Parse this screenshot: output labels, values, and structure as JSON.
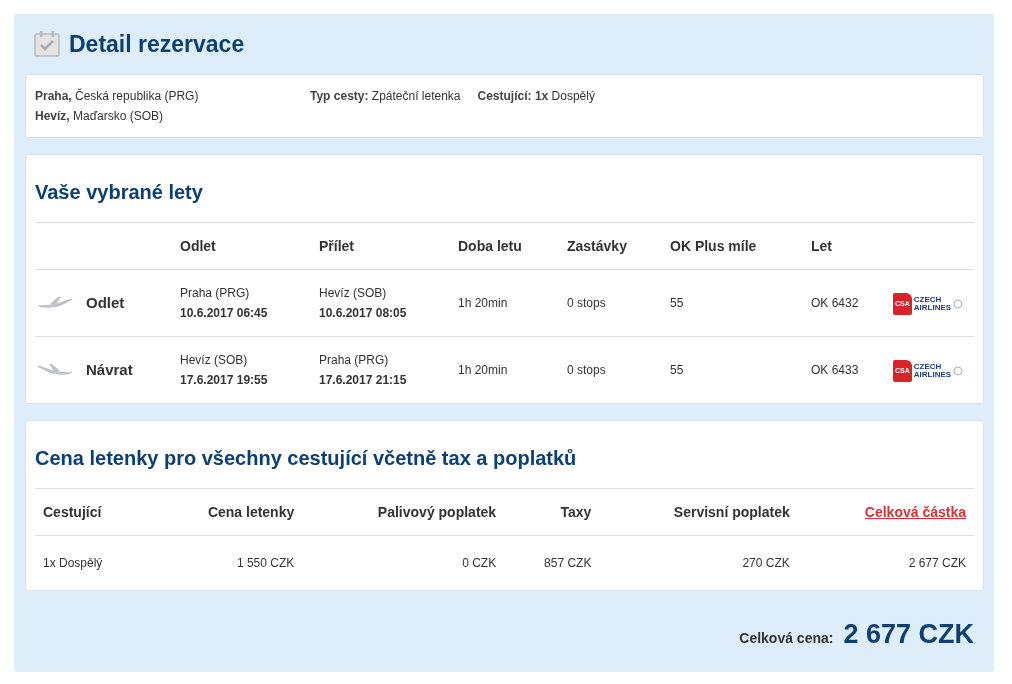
{
  "title": "Detail rezervace",
  "summary": {
    "routes": [
      "**Praha,** Česká republika (PRG)",
      "**Hevíz,** Maďarsko (SOB)"
    ],
    "trip_type": "**Typ cesty:** Zpáteční letenka",
    "passengers": "**Cestující:** **1x** Dospělý"
  },
  "flights": {
    "title": "Vaše vybrané lety",
    "columns": [
      "Odlet",
      "Přílet",
      "Doba letu",
      "Zastávky",
      "OK Plus míle",
      "Let"
    ],
    "rows": [
      {
        "kind": "outbound",
        "label": "Odlet",
        "from": "Praha (PRG)",
        "from_time": "10.6.2017 06:45",
        "to": "Hevíz (SOB)",
        "to_time": "10.6.2017 08:05",
        "duration": "1h 20min",
        "stops": "0 stops",
        "miles": "55",
        "flight": "OK 6432",
        "logo": [
          "CSA",
          "CZECH",
          "AIRLINES"
        ]
      },
      {
        "kind": "return",
        "label": "Návrat",
        "from": "Hevíz (SOB)",
        "from_time": "17.6.2017 19:55",
        "to": "Praha (PRG)",
        "to_time": "17.6.2017 21:15",
        "duration": "1h 20min",
        "stops": "0 stops",
        "miles": "55",
        "flight": "OK 6433",
        "logo": [
          "CSA",
          "CZECH",
          "AIRLINES"
        ]
      }
    ]
  },
  "price": {
    "title": "Cena letenky pro všechny cestující včetně tax a poplatků",
    "columns": [
      {
        "label": "Cestující",
        "kind": "text"
      },
      {
        "label": "Cena letenky",
        "kind": "text"
      },
      {
        "label": "Palivový poplatek",
        "kind": "text"
      },
      {
        "label": "Taxy",
        "kind": "text"
      },
      {
        "label": "Servisní poplatek",
        "kind": "text"
      },
      {
        "label": "Celková částka",
        "kind": "link"
      }
    ],
    "rows": [
      [
        "1x Dospělý",
        "1 550 CZK",
        "0 CZK",
        "857 CZK",
        "270 CZK",
        "2 677 CZK"
      ]
    ]
  },
  "total": {
    "label": "Celková cena:",
    "value": "2 677 CZK"
  }
}
